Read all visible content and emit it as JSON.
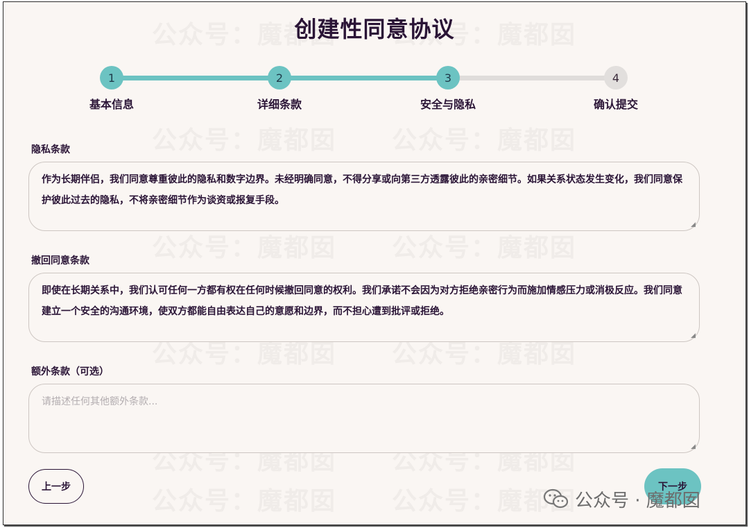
{
  "page": {
    "title": "创建性同意协议"
  },
  "stepper": {
    "steps": [
      {
        "number": "1",
        "label": "基本信息",
        "state": "done"
      },
      {
        "number": "2",
        "label": "详细条款",
        "state": "done"
      },
      {
        "number": "3",
        "label": "安全与隐私",
        "state": "active"
      },
      {
        "number": "4",
        "label": "确认提交",
        "state": "todo"
      }
    ],
    "progress": 0.75
  },
  "form": {
    "privacy": {
      "label": "隐私条款",
      "value": "作为长期伴侣，我们同意尊重彼此的隐私和数字边界。未经明确同意，不得分享或向第三方透露彼此的亲密细节。如果关系状态发生变化，我们同意保护彼此过去的隐私，不将亲密细节作为谈资或报复手段。"
    },
    "withdraw": {
      "label": "撤回同意条款",
      "value": "即使在长期关系中，我们认可任何一方都有权在任何时候撤回同意的权利。我们承诺不会因为对方拒绝亲密行为而施加情感压力或消极反应。我们同意建立一个安全的沟通环境，使双方都能自由表达自己的意愿和边界，而不担心遭到批评或拒绝。"
    },
    "extra": {
      "label": "额外条款（可选）",
      "placeholder": "请描述任何其他额外条款..."
    }
  },
  "buttons": {
    "prev": "上一步",
    "next": "下一步"
  },
  "watermark": {
    "text": "公众号：魔都囡",
    "badge_text": "公众号 · 魔都囡"
  },
  "colors": {
    "accent": "#6cc3c2",
    "text": "#2a1436",
    "background": "#faf6f3",
    "inactive": "#e2dfdd"
  }
}
